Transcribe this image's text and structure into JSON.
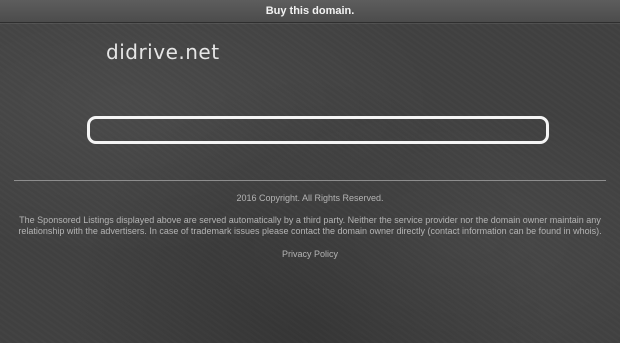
{
  "topbar": {
    "label": "Buy this domain."
  },
  "header": {
    "domain": "didrive.net"
  },
  "search": {
    "value": "",
    "placeholder": ""
  },
  "footer": {
    "copyright": "2016 Copyright. All Rights Reserved.",
    "disclaimer": "The Sponsored Listings displayed above are served automatically by a third party. Neither the service provider nor the domain owner maintain any relationship with the advertisers. In case of trademark issues please contact the domain owner directly (contact information can be found in whois).",
    "privacy_label": "Privacy Policy"
  },
  "colors": {
    "background": "#414141",
    "topbar": "#555555",
    "title_text": "#e6e6e6",
    "search_border": "#f5f5f5",
    "footer_text": "#b4b4b4"
  }
}
